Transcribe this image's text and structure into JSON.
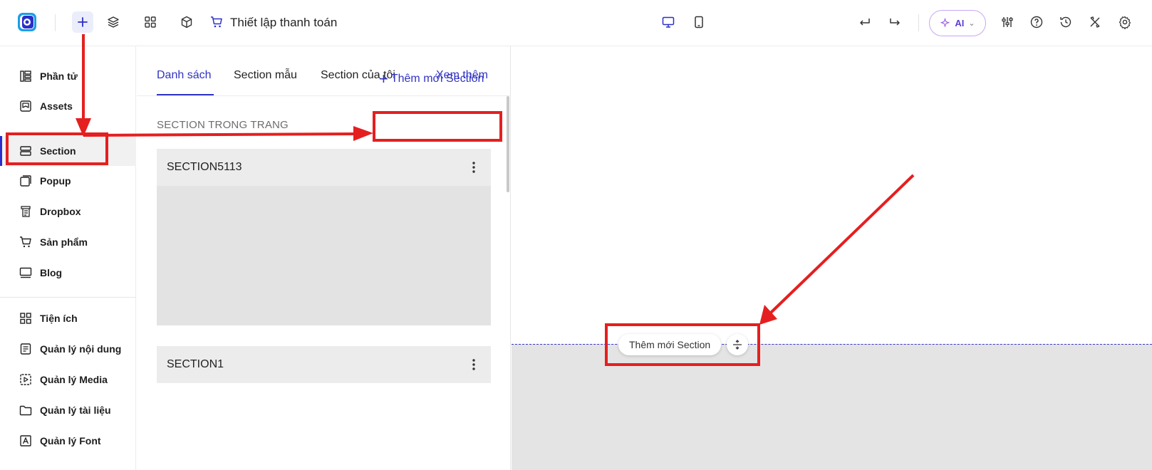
{
  "topbar": {
    "page_title": "Thiết lập thanh toán",
    "ai_label": "AI",
    "icons": [
      "app-logo",
      "plus-icon",
      "layers-icon",
      "grid-icon",
      "box-icon",
      "cart-icon",
      "desktop-icon",
      "tablet-icon",
      "undo-icon",
      "redo-icon",
      "sliders-icon",
      "help-icon",
      "history-icon",
      "tools-icon",
      "settings-icon"
    ]
  },
  "sidebar": {
    "items": [
      {
        "label": "Phần tử",
        "icon": "elements-icon"
      },
      {
        "label": "Assets",
        "icon": "assets-icon"
      },
      {
        "label": "Section",
        "icon": "section-icon",
        "active": true
      },
      {
        "label": "Popup",
        "icon": "popup-icon"
      },
      {
        "label": "Dropbox",
        "icon": "dropbox-icon"
      },
      {
        "label": "Sản phẩm",
        "icon": "cart-icon"
      },
      {
        "label": "Blog",
        "icon": "blog-icon"
      },
      {
        "label": "Tiện ích",
        "icon": "widgets-icon"
      },
      {
        "label": "Quản lý nội dung",
        "icon": "content-icon"
      },
      {
        "label": "Quản lý Media",
        "icon": "media-icon"
      },
      {
        "label": "Quản lý tài liệu",
        "icon": "folder-icon"
      },
      {
        "label": "Quản lý Font",
        "icon": "font-icon"
      }
    ]
  },
  "panel": {
    "tabs": [
      "Danh sách",
      "Section mẫu",
      "Section của tôi"
    ],
    "more_label": "Xem thêm",
    "heading": "SECTION TRONG TRANG",
    "add_label": "Thêm mới Section",
    "sections": [
      {
        "name": "SECTION5113"
      },
      {
        "name": "SECTION1"
      }
    ]
  },
  "canvas": {
    "add_pill_label": "Thêm mới Section"
  },
  "colors": {
    "accent": "#3034c2",
    "annotation": "#e51f1f",
    "active_bg": "#f1f1f1",
    "card_bg": "#e3e3e3"
  }
}
